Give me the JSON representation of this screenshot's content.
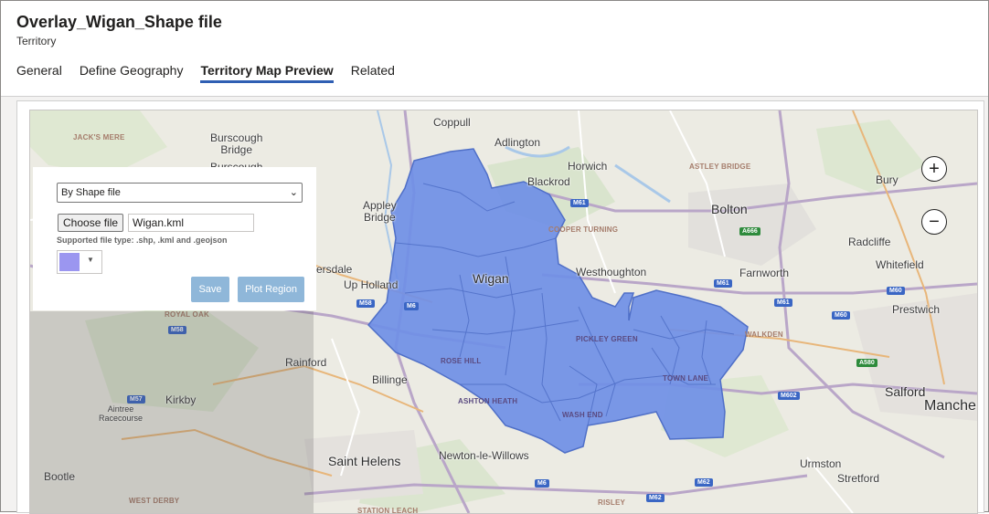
{
  "header": {
    "title": "Overlay_Wigan_Shape file",
    "subtitle": "Territory",
    "tabs": [
      {
        "label": "General"
      },
      {
        "label": "Define Geography"
      },
      {
        "label": "Territory Map Preview"
      },
      {
        "label": "Related"
      }
    ]
  },
  "controls": {
    "mode_value": "By Shape file",
    "choose_label": "Choose file",
    "file_name": "Wigan.kml",
    "hint": "Supported file type: .shp, .kml and .geojson",
    "fill_color": "#9b96f0",
    "save_label": "Save",
    "plot_label": "Plot Region"
  },
  "map": {
    "zoom_in": "+",
    "zoom_out": "−",
    "region_color": "#6f8fe6",
    "towns": {
      "coppull": "Coppull",
      "adlington": "Adlington",
      "horwich": "Horwich",
      "blackrod": "Blackrod",
      "bolton": "Bolton",
      "bury": "Bury",
      "burscough_bridge": "Burscough\nBridge",
      "burscough": "Burscough",
      "appley_bridge": "Appley\nBridge",
      "wigan": "Wigan",
      "westhoughton": "Westhoughton",
      "farnworth": "Farnworth",
      "radcliffe": "Radcliffe",
      "whitefield": "Whitefield",
      "prestwich": "Prestwich",
      "up_holland": "Up Holland",
      "skelmersdale": "ersdale",
      "rainford": "Rainford",
      "billinge": "Billinge",
      "kirkby": "Kirkby",
      "aintree": "Aintree\nRacecourse",
      "salford": "Salford",
      "manchester": "Manche",
      "st_helens": "Saint Helens",
      "newton": "Newton-le-Willows",
      "bootle": "Bootle",
      "urmston": "Urmston",
      "stretford": "Stretford"
    },
    "districts": {
      "jacks_mere": "JACK'S MERE",
      "astley_bridge": "ASTLEY BRIDGE",
      "cooper_turning": "COOPER TURNING",
      "royal_oak": "ROYAL OAK",
      "rose_hill": "ROSE HILL",
      "pickley_green": "PICKLEY GREEN",
      "walkden": "WALKDEN",
      "town_lane": "TOWN LANE",
      "ashton_heath": "ASHTON HEATH",
      "wash_end": "WASH END",
      "west_derby": "WEST DERBY",
      "stanton_leach": "STATION LEACH",
      "risley": "RISLEY"
    },
    "shields": {
      "m61a": "M61",
      "m61b": "M61",
      "m61c": "M61",
      "a666": "A666",
      "m58": "M58",
      "m6a": "M6",
      "m58b": "M58",
      "m60a": "M60",
      "m60b": "M60",
      "a580": "A580",
      "m57": "M57",
      "m602": "M602",
      "m62": "M62",
      "m62b": "M62",
      "m6b": "M6"
    }
  }
}
